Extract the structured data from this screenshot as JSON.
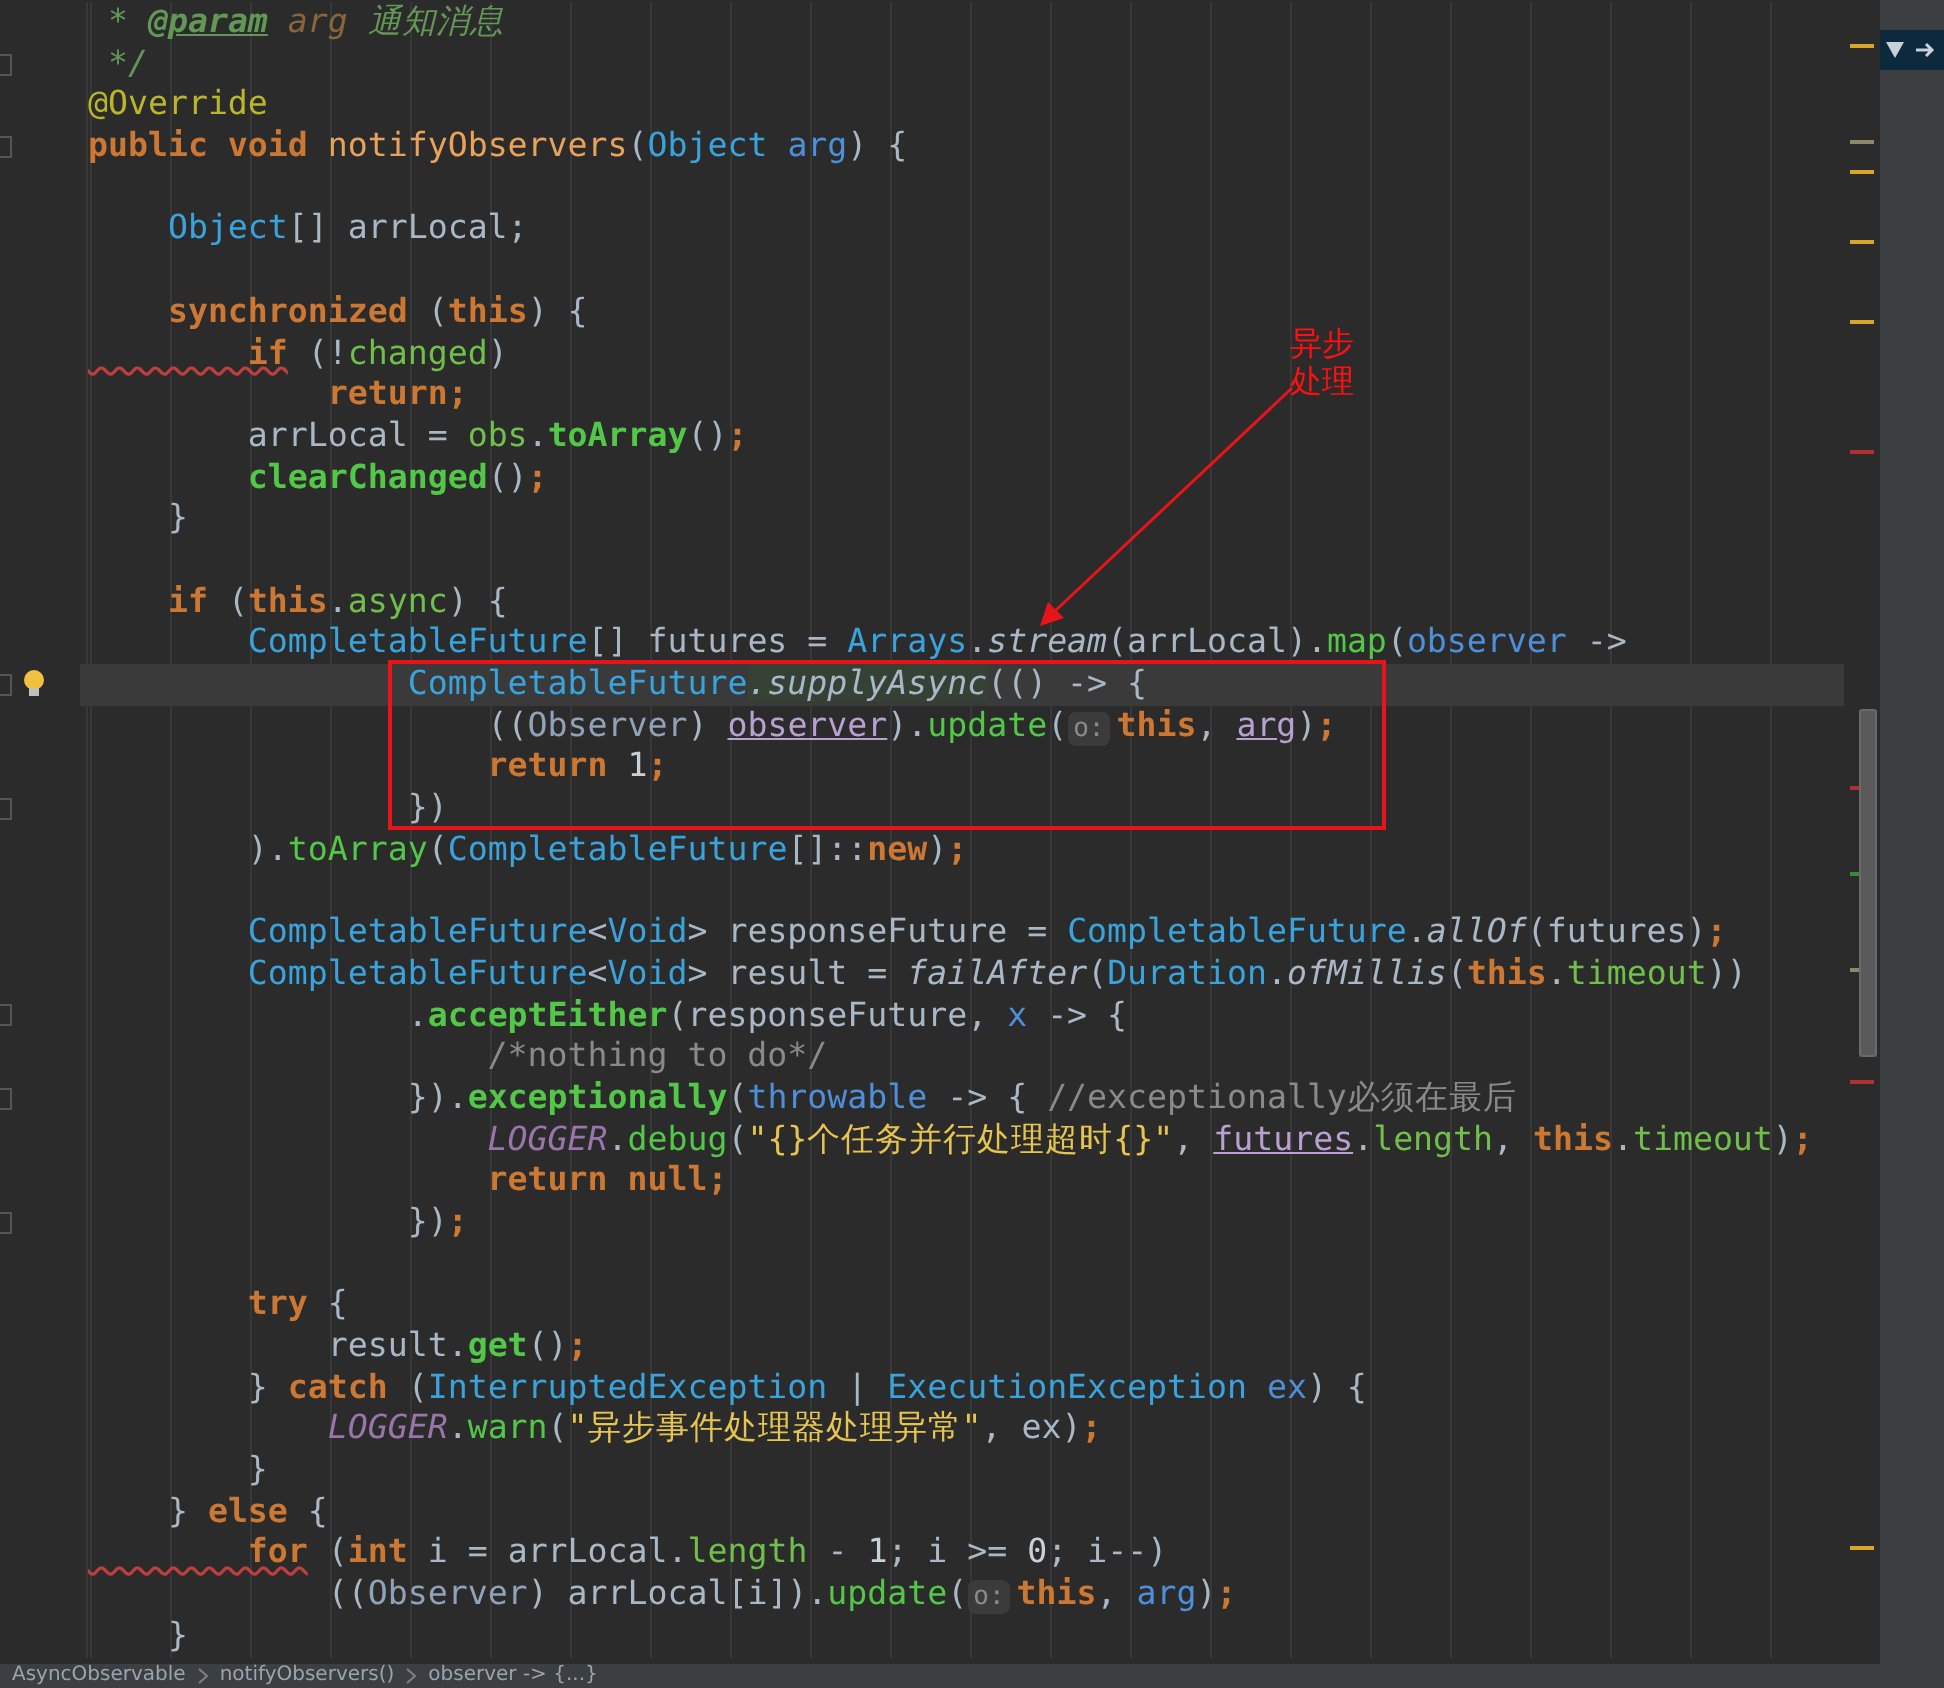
{
  "editor": {
    "lines": [
      {
        "current": false,
        "fold": false,
        "tokens": [
          {
            "kind": "doc",
            "text": " * "
          },
          {
            "kind": "doctag",
            "text": "@param"
          },
          {
            "kind": "docarg",
            "text": " arg"
          },
          {
            "kind": "doc",
            "text": " 通知消息"
          }
        ]
      },
      {
        "current": false,
        "fold": true,
        "tokens": [
          {
            "kind": "doc",
            "text": " */"
          }
        ]
      },
      {
        "current": false,
        "fold": false,
        "tokens": [
          {
            "kind": "ann",
            "text": "@Override"
          }
        ]
      },
      {
        "current": false,
        "fold": true,
        "tokens": [
          {
            "kind": "kw",
            "text": "public void "
          },
          {
            "kind": "decl",
            "text": "notifyObservers"
          },
          {
            "kind": "plain",
            "text": "("
          },
          {
            "kind": "type",
            "text": "Object "
          },
          {
            "kind": "param",
            "text": "arg"
          },
          {
            "kind": "plain",
            "text": ") {"
          }
        ]
      },
      {
        "current": false,
        "fold": false,
        "gap_before": true,
        "tokens": [
          {
            "kind": "type",
            "text": "    Object"
          },
          {
            "kind": "plain",
            "text": "[] arrLocal;"
          }
        ]
      },
      {
        "current": false,
        "fold": false,
        "gap_before": true,
        "tokens": [
          {
            "kind": "kw",
            "text": "    synchronized"
          },
          {
            "kind": "plain",
            "text": " ("
          },
          {
            "kind": "kw",
            "text": "this"
          },
          {
            "kind": "plain",
            "text": ") {"
          }
        ]
      },
      {
        "current": false,
        "fold": false,
        "tokens": [
          {
            "kind": "kwwarn",
            "text": "        if"
          },
          {
            "kind": "plain",
            "text": " (!"
          },
          {
            "kind": "field",
            "text": "changed"
          },
          {
            "kind": "plain",
            "text": ")"
          }
        ]
      },
      {
        "current": false,
        "fold": false,
        "tokens": [
          {
            "kind": "kw",
            "text": "            return"
          },
          {
            "kind": "semi",
            "text": ";"
          }
        ]
      },
      {
        "current": false,
        "fold": false,
        "tokens": [
          {
            "kind": "plain",
            "text": "        arrLocal = "
          },
          {
            "kind": "field",
            "text": "obs"
          },
          {
            "kind": "plain",
            "text": "."
          },
          {
            "kind": "callb",
            "text": "toArray"
          },
          {
            "kind": "plain",
            "text": "()"
          },
          {
            "kind": "semi",
            "text": ";"
          }
        ]
      },
      {
        "current": false,
        "fold": false,
        "tokens": [
          {
            "kind": "callb",
            "text": "        clearChanged"
          },
          {
            "kind": "plain",
            "text": "()"
          },
          {
            "kind": "semi",
            "text": ";"
          }
        ]
      },
      {
        "current": false,
        "fold": false,
        "tokens": [
          {
            "kind": "plain",
            "text": "    }"
          }
        ]
      },
      {
        "current": false,
        "fold": false,
        "gap_before": true,
        "tokens": [
          {
            "kind": "kw",
            "text": "    if"
          },
          {
            "kind": "plain",
            "text": " ("
          },
          {
            "kind": "kw",
            "text": "this"
          },
          {
            "kind": "plain",
            "text": "."
          },
          {
            "kind": "field",
            "text": "async"
          },
          {
            "kind": "plain",
            "text": ") {"
          }
        ]
      },
      {
        "current": false,
        "fold": false,
        "tokens": [
          {
            "kind": "type",
            "text": "        CompletableFuture"
          },
          {
            "kind": "plain",
            "text": "[] futures = "
          },
          {
            "kind": "type",
            "text": "Arrays"
          },
          {
            "kind": "plain",
            "text": "."
          },
          {
            "kind": "static",
            "text": "stream"
          },
          {
            "kind": "plain",
            "text": "(arrLocal)."
          },
          {
            "kind": "call",
            "text": "map"
          },
          {
            "kind": "plain",
            "text": "("
          },
          {
            "kind": "param",
            "text": "observer"
          },
          {
            "kind": "plain",
            "text": " ->"
          }
        ]
      },
      {
        "current": true,
        "fold": true,
        "tokens": [
          {
            "kind": "type",
            "text": "                CompletableFuture"
          },
          {
            "kind": "statichl",
            "text": ".supplyAsync"
          },
          {
            "kind": "plain",
            "text": "(() -> {"
          }
        ]
      },
      {
        "current": false,
        "fold": false,
        "tokens": [
          {
            "kind": "plain",
            "text": "                    (("
          },
          {
            "kind": "cast",
            "text": "Observer"
          },
          {
            "kind": "plain",
            "text": ") "
          },
          {
            "kind": "ref",
            "text": "observer"
          },
          {
            "kind": "plain",
            "text": ")."
          },
          {
            "kind": "call",
            "text": "update"
          },
          {
            "kind": "plain",
            "text": "("
          },
          {
            "kind": "hint",
            "text": "o:"
          },
          {
            "kind": "kw",
            "text": "this"
          },
          {
            "kind": "plain",
            "text": ", "
          },
          {
            "kind": "ref",
            "text": "arg"
          },
          {
            "kind": "plain",
            "text": ")"
          },
          {
            "kind": "semi",
            "text": ";"
          }
        ]
      },
      {
        "current": false,
        "fold": false,
        "tokens": [
          {
            "kind": "kw",
            "text": "                    return"
          },
          {
            "kind": "num",
            "text": " 1"
          },
          {
            "kind": "semi",
            "text": ";"
          }
        ]
      },
      {
        "current": false,
        "fold": true,
        "tokens": [
          {
            "kind": "plain",
            "text": "                })"
          }
        ]
      },
      {
        "current": false,
        "fold": false,
        "tokens": [
          {
            "kind": "plain",
            "text": "        )."
          },
          {
            "kind": "call",
            "text": "toArray"
          },
          {
            "kind": "plain",
            "text": "("
          },
          {
            "kind": "type",
            "text": "CompletableFuture"
          },
          {
            "kind": "plain",
            "text": "[]::"
          },
          {
            "kind": "kw",
            "text": "new"
          },
          {
            "kind": "plain",
            "text": ")"
          },
          {
            "kind": "semi",
            "text": ";"
          }
        ]
      },
      {
        "current": false,
        "fold": false,
        "gap_before": true,
        "tokens": [
          {
            "kind": "type",
            "text": "        CompletableFuture"
          },
          {
            "kind": "plain",
            "text": "<"
          },
          {
            "kind": "type",
            "text": "Void"
          },
          {
            "kind": "plain",
            "text": "> responseFuture = "
          },
          {
            "kind": "type",
            "text": "CompletableFuture"
          },
          {
            "kind": "plain",
            "text": "."
          },
          {
            "kind": "static",
            "text": "allOf"
          },
          {
            "kind": "plain",
            "text": "(futures)"
          },
          {
            "kind": "semi",
            "text": ";"
          }
        ]
      },
      {
        "current": false,
        "fold": false,
        "tokens": [
          {
            "kind": "type",
            "text": "        CompletableFuture"
          },
          {
            "kind": "plain",
            "text": "<"
          },
          {
            "kind": "type",
            "text": "Void"
          },
          {
            "kind": "plain",
            "text": "> result = "
          },
          {
            "kind": "static",
            "text": "failAfter"
          },
          {
            "kind": "plain",
            "text": "("
          },
          {
            "kind": "type",
            "text": "Duration"
          },
          {
            "kind": "plain",
            "text": "."
          },
          {
            "kind": "static",
            "text": "ofMillis"
          },
          {
            "kind": "plain",
            "text": "("
          },
          {
            "kind": "kw",
            "text": "this"
          },
          {
            "kind": "plain",
            "text": "."
          },
          {
            "kind": "field",
            "text": "timeout"
          },
          {
            "kind": "plain",
            "text": "))"
          }
        ]
      },
      {
        "current": false,
        "fold": true,
        "tokens": [
          {
            "kind": "plain",
            "text": "                ."
          },
          {
            "kind": "callb",
            "text": "acceptEither"
          },
          {
            "kind": "plain",
            "text": "(responseFuture, "
          },
          {
            "kind": "param",
            "text": "x"
          },
          {
            "kind": "plain",
            "text": " -> {"
          }
        ]
      },
      {
        "current": false,
        "fold": false,
        "tokens": [
          {
            "kind": "cmt",
            "text": "                    /*nothing to do*/"
          }
        ]
      },
      {
        "current": false,
        "fold": true,
        "tokens": [
          {
            "kind": "plain",
            "text": "                })."
          },
          {
            "kind": "callb",
            "text": "exceptionally"
          },
          {
            "kind": "plain",
            "text": "("
          },
          {
            "kind": "param",
            "text": "throwable"
          },
          {
            "kind": "plain",
            "text": " -> {"
          },
          {
            "kind": "cmt",
            "text": " //exceptionally必须在最后"
          }
        ]
      },
      {
        "current": false,
        "fold": false,
        "tokens": [
          {
            "kind": "const",
            "text": "                    LOGGER"
          },
          {
            "kind": "plain",
            "text": "."
          },
          {
            "kind": "call",
            "text": "debug"
          },
          {
            "kind": "plain",
            "text": "("
          },
          {
            "kind": "str",
            "text": "\"{}个任务并行处理超时{}\""
          },
          {
            "kind": "plain",
            "text": ", "
          },
          {
            "kind": "ref",
            "text": "futures"
          },
          {
            "kind": "plain",
            "text": "."
          },
          {
            "kind": "field",
            "text": "length"
          },
          {
            "kind": "plain",
            "text": ", "
          },
          {
            "kind": "kw",
            "text": "this"
          },
          {
            "kind": "plain",
            "text": "."
          },
          {
            "kind": "field",
            "text": "timeout"
          },
          {
            "kind": "plain",
            "text": ")"
          },
          {
            "kind": "semi",
            "text": ";"
          }
        ]
      },
      {
        "current": false,
        "fold": false,
        "tokens": [
          {
            "kind": "kw",
            "text": "                    return null"
          },
          {
            "kind": "semi",
            "text": ";"
          }
        ]
      },
      {
        "current": false,
        "fold": true,
        "tokens": [
          {
            "kind": "plain",
            "text": "                })"
          },
          {
            "kind": "semi",
            "text": ";"
          }
        ]
      },
      {
        "current": false,
        "fold": false,
        "gap_before": true,
        "tokens": [
          {
            "kind": "kw",
            "text": "        try"
          },
          {
            "kind": "plain",
            "text": " {"
          }
        ]
      },
      {
        "current": false,
        "fold": false,
        "tokens": [
          {
            "kind": "plain",
            "text": "            result."
          },
          {
            "kind": "callb",
            "text": "get"
          },
          {
            "kind": "plain",
            "text": "()"
          },
          {
            "kind": "semi",
            "text": ";"
          }
        ]
      },
      {
        "current": false,
        "fold": false,
        "tokens": [
          {
            "kind": "plain",
            "text": "        } "
          },
          {
            "kind": "kw",
            "text": "catch"
          },
          {
            "kind": "plain",
            "text": " ("
          },
          {
            "kind": "type",
            "text": "InterruptedException"
          },
          {
            "kind": "plain",
            "text": " | "
          },
          {
            "kind": "type",
            "text": "ExecutionException"
          },
          {
            "kind": "param",
            "text": " ex"
          },
          {
            "kind": "plain",
            "text": ") {"
          }
        ]
      },
      {
        "current": false,
        "fold": false,
        "tokens": [
          {
            "kind": "const",
            "text": "            LOGGER"
          },
          {
            "kind": "plain",
            "text": "."
          },
          {
            "kind": "call",
            "text": "warn"
          },
          {
            "kind": "plain",
            "text": "("
          },
          {
            "kind": "str",
            "text": "\"异步事件处理器处理异常\""
          },
          {
            "kind": "plain",
            "text": ", ex)"
          },
          {
            "kind": "semi",
            "text": ";"
          }
        ]
      },
      {
        "current": false,
        "fold": false,
        "tokens": [
          {
            "kind": "plain",
            "text": "        }"
          }
        ]
      },
      {
        "current": false,
        "fold": false,
        "tokens": [
          {
            "kind": "plain",
            "text": "    } "
          },
          {
            "kind": "kw",
            "text": "else"
          },
          {
            "kind": "plain",
            "text": " {"
          }
        ]
      },
      {
        "current": false,
        "fold": false,
        "tokens": [
          {
            "kind": "kwwarn",
            "text": "        for"
          },
          {
            "kind": "plain",
            "text": " ("
          },
          {
            "kind": "kw",
            "text": "int"
          },
          {
            "kind": "plain",
            "text": " i = arrLocal."
          },
          {
            "kind": "field",
            "text": "length"
          },
          {
            "kind": "plain",
            "text": " - "
          },
          {
            "kind": "num",
            "text": "1"
          },
          {
            "kind": "plain",
            "text": "; i >= "
          },
          {
            "kind": "num",
            "text": "0"
          },
          {
            "kind": "plain",
            "text": "; i--)"
          }
        ]
      },
      {
        "current": false,
        "fold": false,
        "tokens": [
          {
            "kind": "plain",
            "text": "            (("
          },
          {
            "kind": "cast",
            "text": "Observer"
          },
          {
            "kind": "plain",
            "text": ") arrLocal[i])."
          },
          {
            "kind": "call",
            "text": "update"
          },
          {
            "kind": "plain",
            "text": "("
          },
          {
            "kind": "hint",
            "text": "o:"
          },
          {
            "kind": "kw",
            "text": "this"
          },
          {
            "kind": "plain",
            "text": ", "
          },
          {
            "kind": "param",
            "text": "arg"
          },
          {
            "kind": "plain",
            "text": ")"
          },
          {
            "kind": "semi",
            "text": ";"
          }
        ]
      },
      {
        "current": false,
        "fold": false,
        "tokens": [
          {
            "kind": "plain",
            "text": "    }"
          }
        ]
      }
    ],
    "annotation": {
      "label_lines": [
        "异步",
        "处理"
      ]
    }
  },
  "breadcrumb": [
    "AsyncObservable",
    "notifyObservers()",
    "observer -> {...}"
  ]
}
